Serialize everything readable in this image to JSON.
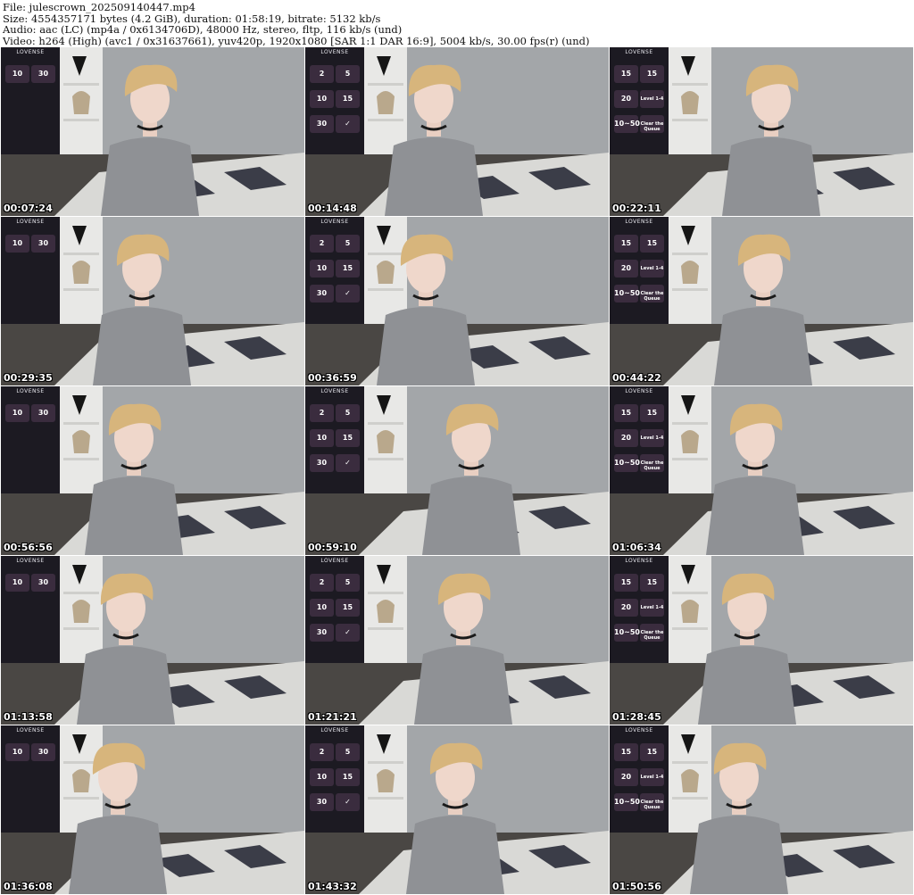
{
  "header": {
    "file_line": "File: julescrown_202509140447.mp4",
    "size_line": "Size: 4554357171 bytes (4.2 GiB), duration: 01:58:19, bitrate: 5132 kb/s",
    "audio_line": "Audio: aac (LC) (mp4a / 0x6134706D), 48000 Hz, stereo, fltp, 116 kb/s (und)",
    "video_line": "Video: h264 (High) (avc1 / 0x31637661), yuv420p, 1920x1080 [SAR 1:1 DAR 16:9], 5004 kb/s, 30.00 fps(r) (und)"
  },
  "overlay_brand": "LOVENSE",
  "thumbnails": [
    {
      "timestamp": "00:07:24",
      "panel": "a",
      "v": [
        "10",
        "30"
      ]
    },
    {
      "timestamp": "00:14:48",
      "panel": "b",
      "v": [
        "2",
        "5",
        "10",
        "15",
        "30",
        "✓"
      ]
    },
    {
      "timestamp": "00:22:11",
      "panel": "c",
      "v": [
        "15",
        "15",
        "20",
        "Level 1-4",
        "10~50",
        "Clear the Queue"
      ]
    },
    {
      "timestamp": "00:29:35",
      "panel": "a",
      "v": [
        "10",
        "30"
      ]
    },
    {
      "timestamp": "00:36:59",
      "panel": "b",
      "v": [
        "2",
        "5",
        "10",
        "15",
        "30",
        "✓"
      ]
    },
    {
      "timestamp": "00:44:22",
      "panel": "c",
      "v": [
        "15",
        "15",
        "20",
        "Level 1-4",
        "10~50",
        "Clear the Queue"
      ]
    },
    {
      "timestamp": "00:56:56",
      "panel": "a",
      "v": [
        "10",
        "30"
      ]
    },
    {
      "timestamp": "00:59:10",
      "panel": "b",
      "v": [
        "2",
        "5",
        "10",
        "15",
        "30",
        "✓"
      ]
    },
    {
      "timestamp": "01:06:34",
      "panel": "c",
      "v": [
        "15",
        "15",
        "20",
        "Level 1-4",
        "10~50",
        "Clear the Queue"
      ]
    },
    {
      "timestamp": "01:13:58",
      "panel": "a",
      "v": [
        "10",
        "30"
      ]
    },
    {
      "timestamp": "01:21:21",
      "panel": "b",
      "v": [
        "2",
        "5",
        "10",
        "15",
        "30",
        "✓"
      ]
    },
    {
      "timestamp": "01:28:45",
      "panel": "c",
      "v": [
        "15",
        "15",
        "20",
        "Level 1-4",
        "10~50",
        "Clear the Queue"
      ]
    },
    {
      "timestamp": "01:36:08",
      "panel": "a",
      "v": [
        "10",
        "30"
      ]
    },
    {
      "timestamp": "01:43:32",
      "panel": "b",
      "v": [
        "2",
        "5",
        "10",
        "15",
        "30",
        "✓"
      ]
    },
    {
      "timestamp": "01:50:56",
      "panel": "c",
      "v": [
        "15",
        "15",
        "20",
        "Level 1-4",
        "10~50",
        "Clear the Queue"
      ]
    }
  ]
}
